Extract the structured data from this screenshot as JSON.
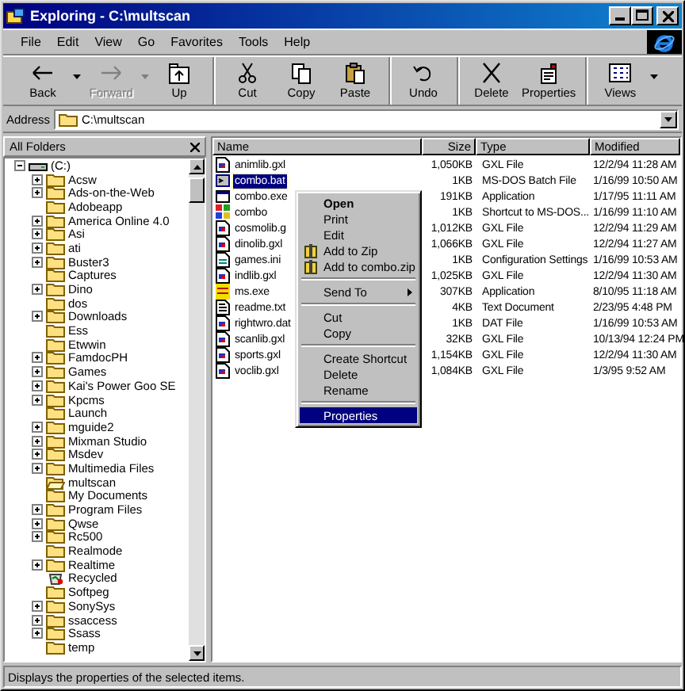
{
  "window": {
    "title": "Exploring - C:\\multscan"
  },
  "menu": [
    "File",
    "Edit",
    "View",
    "Go",
    "Favorites",
    "Tools",
    "Help"
  ],
  "toolbar": {
    "groups": [
      {
        "buttons": [
          {
            "label": "Back",
            "kind": "back",
            "disabled": false,
            "dropdown": true
          },
          {
            "label": "Forward",
            "kind": "forward",
            "disabled": true,
            "dropdown": true
          },
          {
            "label": "Up",
            "kind": "up",
            "disabled": false,
            "dropdown": false
          }
        ]
      },
      {
        "buttons": [
          {
            "label": "Cut",
            "kind": "cut",
            "disabled": false,
            "dropdown": false
          },
          {
            "label": "Copy",
            "kind": "copy",
            "disabled": false,
            "dropdown": false
          },
          {
            "label": "Paste",
            "kind": "paste",
            "disabled": false,
            "dropdown": false
          }
        ]
      },
      {
        "buttons": [
          {
            "label": "Undo",
            "kind": "undo",
            "disabled": false,
            "dropdown": false
          }
        ]
      },
      {
        "buttons": [
          {
            "label": "Delete",
            "kind": "delete",
            "disabled": false,
            "dropdown": false
          },
          {
            "label": "Properties",
            "kind": "properties",
            "disabled": false,
            "dropdown": false
          }
        ]
      },
      {
        "buttons": [
          {
            "label": "Views",
            "kind": "views",
            "disabled": false,
            "dropdown": true
          }
        ]
      }
    ]
  },
  "address": {
    "label": "Address",
    "value": "C:\\multscan"
  },
  "folders_pane": {
    "title": "All Folders"
  },
  "tree": [
    {
      "label": "(C:)",
      "kind": "drive",
      "expanded": true,
      "children": [
        {
          "label": "Acsw",
          "kind": "folder",
          "expandable": true
        },
        {
          "label": "Ads-on-the-Web",
          "kind": "folder",
          "expandable": true
        },
        {
          "label": "Adobeapp",
          "kind": "folder",
          "expandable": false
        },
        {
          "label": "America Online 4.0",
          "kind": "folder",
          "expandable": true
        },
        {
          "label": "Asi",
          "kind": "folder",
          "expandable": true
        },
        {
          "label": "ati",
          "kind": "folder",
          "expandable": true
        },
        {
          "label": "Buster3",
          "kind": "folder",
          "expandable": true
        },
        {
          "label": "Captures",
          "kind": "folder",
          "expandable": false
        },
        {
          "label": "Dino",
          "kind": "folder",
          "expandable": true
        },
        {
          "label": "dos",
          "kind": "folder",
          "expandable": false
        },
        {
          "label": "Downloads",
          "kind": "folder",
          "expandable": true
        },
        {
          "label": "Ess",
          "kind": "folder",
          "expandable": false
        },
        {
          "label": "Etwwin",
          "kind": "folder",
          "expandable": false
        },
        {
          "label": "FamdocPH",
          "kind": "folder",
          "expandable": true
        },
        {
          "label": "Games",
          "kind": "folder",
          "expandable": true
        },
        {
          "label": "Kai's Power Goo SE",
          "kind": "folder",
          "expandable": true
        },
        {
          "label": "Kpcms",
          "kind": "folder",
          "expandable": true
        },
        {
          "label": "Launch",
          "kind": "folder",
          "expandable": false
        },
        {
          "label": "mguide2",
          "kind": "folder",
          "expandable": true
        },
        {
          "label": "Mixman Studio",
          "kind": "folder",
          "expandable": true
        },
        {
          "label": "Msdev",
          "kind": "folder",
          "expandable": true
        },
        {
          "label": "Multimedia Files",
          "kind": "folder",
          "expandable": true
        },
        {
          "label": "multscan",
          "kind": "open-folder",
          "expandable": false
        },
        {
          "label": "My Documents",
          "kind": "folder",
          "expandable": false
        },
        {
          "label": "Program Files",
          "kind": "folder",
          "expandable": true
        },
        {
          "label": "Qwse",
          "kind": "folder",
          "expandable": true
        },
        {
          "label": "Rc500",
          "kind": "folder",
          "expandable": true
        },
        {
          "label": "Realmode",
          "kind": "folder",
          "expandable": false
        },
        {
          "label": "Realtime",
          "kind": "folder",
          "expandable": true
        },
        {
          "label": "Recycled",
          "kind": "recycle",
          "expandable": false
        },
        {
          "label": "Softpeg",
          "kind": "folder",
          "expandable": false
        },
        {
          "label": "SonySys",
          "kind": "folder",
          "expandable": true
        },
        {
          "label": "ssaccess",
          "kind": "folder",
          "expandable": true
        },
        {
          "label": "Ssass",
          "kind": "folder",
          "expandable": true
        },
        {
          "label": "temp",
          "kind": "folder",
          "expandable": false
        }
      ]
    }
  ],
  "files": {
    "columns": [
      "Name",
      "Size",
      "Type",
      "Modified"
    ],
    "rows": [
      {
        "name": "animlib.gxl",
        "size": "1,050KB",
        "type": "GXL File",
        "modified": "12/2/94 11:28 AM",
        "kind": "gxl",
        "selected": false
      },
      {
        "name": "combo.bat",
        "size": "1KB",
        "type": "MS-DOS Batch File",
        "modified": "1/16/99 10:50 AM",
        "kind": "bat",
        "selected": true
      },
      {
        "name": "combo.exe",
        "size": "191KB",
        "type": "Application",
        "modified": "1/17/95 11:11 AM",
        "kind": "exe",
        "selected": false
      },
      {
        "name": "combo",
        "size": "1KB",
        "type": "Shortcut to MS-DOS...",
        "modified": "1/16/99 11:10 AM",
        "kind": "shortcut",
        "selected": false
      },
      {
        "name": "cosmolib.g",
        "size": "1,012KB",
        "type": "GXL File",
        "modified": "12/2/94 11:29 AM",
        "kind": "gxl",
        "selected": false
      },
      {
        "name": "dinolib.gxl",
        "size": "1,066KB",
        "type": "GXL File",
        "modified": "12/2/94 11:27 AM",
        "kind": "gxl",
        "selected": false
      },
      {
        "name": "games.ini",
        "size": "1KB",
        "type": "Configuration Settings",
        "modified": "1/16/99 10:53 AM",
        "kind": "ini",
        "selected": false
      },
      {
        "name": "indlib.gxl",
        "size": "1,025KB",
        "type": "GXL File",
        "modified": "12/2/94 11:30 AM",
        "kind": "gxl",
        "selected": false
      },
      {
        "name": "ms.exe",
        "size": "307KB",
        "type": "Application",
        "modified": "8/10/95 11:18 AM",
        "kind": "msexe",
        "selected": false
      },
      {
        "name": "readme.txt",
        "size": "4KB",
        "type": "Text Document",
        "modified": "2/23/95 4:48 PM",
        "kind": "text",
        "selected": false
      },
      {
        "name": "rightwro.dat",
        "size": "1KB",
        "type": "DAT File",
        "modified": "1/16/99 10:53 AM",
        "kind": "gxl",
        "selected": false
      },
      {
        "name": "scanlib.gxl",
        "size": "32KB",
        "type": "GXL File",
        "modified": "10/13/94 12:24 PM",
        "kind": "gxl",
        "selected": false
      },
      {
        "name": "sports.gxl",
        "size": "1,154KB",
        "type": "GXL File",
        "modified": "12/2/94 11:30 AM",
        "kind": "gxl",
        "selected": false
      },
      {
        "name": "voclib.gxl",
        "size": "1,084KB",
        "type": "GXL File",
        "modified": "1/3/95 9:52 AM",
        "kind": "gxl",
        "selected": false
      }
    ]
  },
  "context_menu": [
    {
      "kind": "item",
      "label": "Open",
      "bold": true,
      "selected": false
    },
    {
      "kind": "item",
      "label": "Print",
      "bold": false,
      "selected": false
    },
    {
      "kind": "item",
      "label": "Edit",
      "bold": false,
      "selected": false
    },
    {
      "kind": "zip",
      "label": "Add to Zip",
      "bold": false,
      "selected": false
    },
    {
      "kind": "zip",
      "label": "Add to combo.zip",
      "bold": false,
      "selected": false
    },
    {
      "kind": "separator"
    },
    {
      "kind": "submenu",
      "label": "Send To",
      "bold": false,
      "selected": false
    },
    {
      "kind": "separator"
    },
    {
      "kind": "item",
      "label": "Cut",
      "bold": false,
      "selected": false
    },
    {
      "kind": "item",
      "label": "Copy",
      "bold": false,
      "selected": false
    },
    {
      "kind": "separator"
    },
    {
      "kind": "item",
      "label": "Create Shortcut",
      "bold": false,
      "selected": false
    },
    {
      "kind": "item",
      "label": "Delete",
      "bold": false,
      "selected": false
    },
    {
      "kind": "item",
      "label": "Rename",
      "bold": false,
      "selected": false
    },
    {
      "kind": "separator"
    },
    {
      "kind": "item",
      "label": "Properties",
      "bold": false,
      "selected": true
    }
  ],
  "status_bar": "Displays the properties of the selected items."
}
